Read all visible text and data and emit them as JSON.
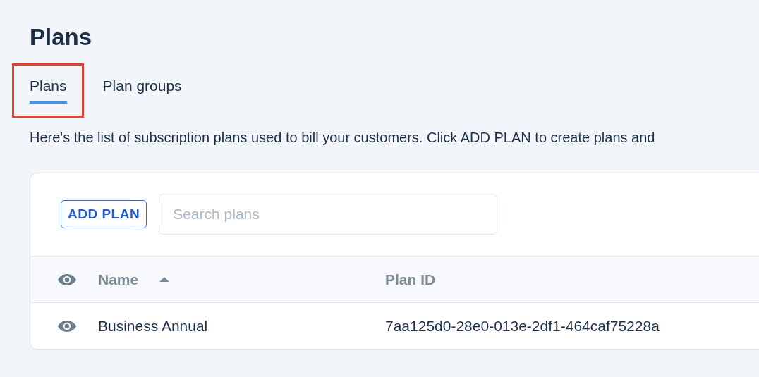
{
  "page_title": "Plans",
  "tabs": [
    {
      "label": "Plans",
      "selected": true,
      "highlighted": true
    },
    {
      "label": "Plan groups",
      "selected": false,
      "highlighted": false
    }
  ],
  "description": "Here's the list of subscription plans used to bill your customers. Click ADD PLAN to create plans and",
  "toolbar": {
    "add_button": "ADD PLAN",
    "search": {
      "placeholder": "Search plans"
    }
  },
  "table": {
    "columns": [
      {
        "label": "Name",
        "sorted": true
      },
      {
        "label": "Plan ID",
        "sorted": false
      }
    ],
    "rows": [
      {
        "name": "Business Annual",
        "plan_id": "7aa125d0-28e0-013e-2df1-464caf75228a"
      }
    ]
  }
}
